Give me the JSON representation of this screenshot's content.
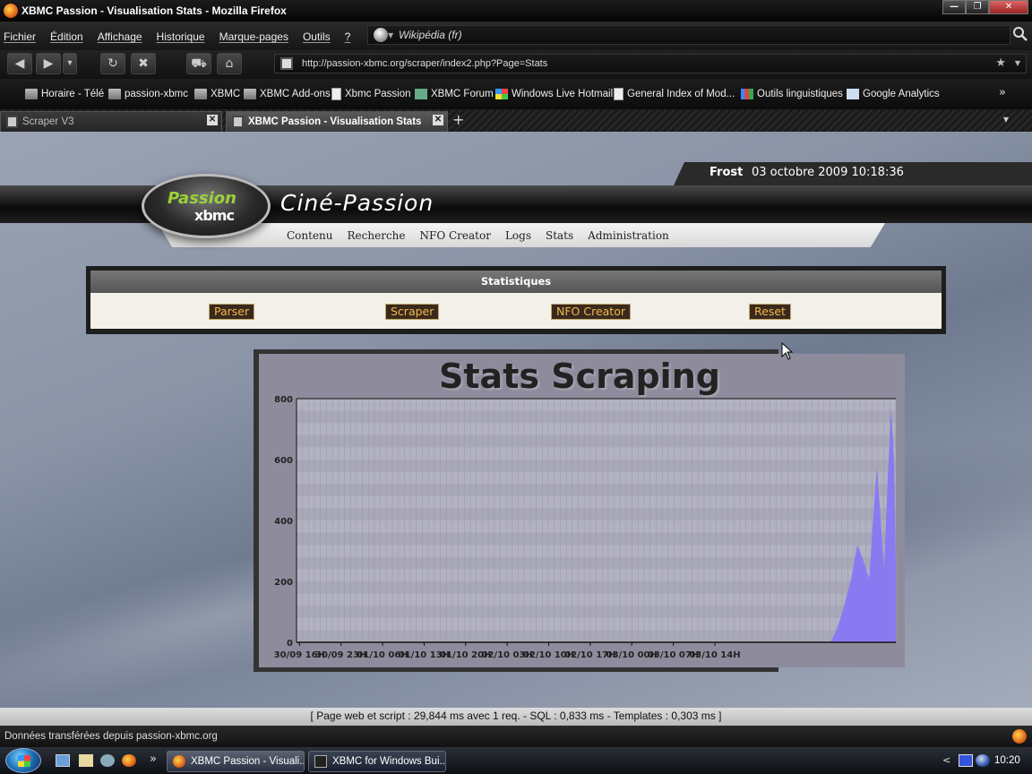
{
  "window": {
    "title": "XBMC Passion - Visualisation Stats - Mozilla Firefox",
    "buttons": {
      "minimize": "—",
      "maximize": "❐",
      "close": "✕"
    }
  },
  "menu": {
    "items": [
      "Fichier",
      "Édition",
      "Affichage",
      "Historique",
      "Marque-pages",
      "Outils",
      "?"
    ]
  },
  "search": {
    "placeholder": "Wikipédia (fr)"
  },
  "nav": {
    "back": "◀",
    "forward": "▶",
    "history": "▾",
    "reload": "↻",
    "stop": "✖",
    "print": "⛟",
    "home": "⌂",
    "url": "http://passion-xbmc.org/scraper/index2.php?Page=Stats",
    "star": "★",
    "dropdown": "▼"
  },
  "bookmarks": [
    {
      "label": "Horaire - Télé",
      "icon": "folder-icon"
    },
    {
      "label": "passion-xbmc",
      "icon": "folder-icon"
    },
    {
      "label": "XBMC",
      "icon": "folder-icon"
    },
    {
      "label": "XBMC Add-ons",
      "icon": "folder-icon"
    },
    {
      "label": "Xbmc Passion",
      "icon": "page-icon"
    },
    {
      "label": "XBMC Forum",
      "icon": "xbmc-icon"
    },
    {
      "label": "Windows Live Hotmail",
      "icon": "windows-icon"
    },
    {
      "label": "General Index of Mod...",
      "icon": "page-icon"
    },
    {
      "label": "Outils linguistiques",
      "icon": "google-icon"
    },
    {
      "label": "Google Analytics",
      "icon": "analytics-icon"
    }
  ],
  "bookmarks_more": "»",
  "tabs": [
    {
      "label": "Scraper V3",
      "active": false
    },
    {
      "label": "XBMC Passion - Visualisation Stats",
      "active": true
    }
  ],
  "tab_close": "✕",
  "new_tab": "+",
  "tab_list": "▾",
  "site": {
    "user": "Frost",
    "datetime": "03 octobre 2009 10:18:36",
    "logo_top": "Passion",
    "logo_bottom": "xbmc",
    "name": "Ciné-Passion",
    "nav": [
      "Contenu",
      "Recherche",
      "NFO Creator",
      "Logs",
      "Stats",
      "Administration"
    ]
  },
  "stats": {
    "heading": "Statistiques",
    "buttons": [
      "Parser",
      "Scraper",
      "NFO Creator",
      "Reset"
    ]
  },
  "chart_data": {
    "type": "area",
    "title": "Stats Scraping",
    "xlabel": "",
    "ylabel": "",
    "ylim": [
      0,
      800
    ],
    "yticks": [
      0,
      200,
      400,
      600,
      800
    ],
    "xticks": [
      "30/09 16H",
      "30/09 23H",
      "01/10 06H",
      "01/10 13H",
      "01/10 20H",
      "02/10 03H",
      "02/10 10H",
      "02/10 17H",
      "03/10 00H",
      "03/10 07H",
      "03/10 14H"
    ],
    "grid": true,
    "legend": "none",
    "series_color": "#8a7af2",
    "x_range_hours": [
      0,
      101
    ],
    "points": [
      {
        "h": 0,
        "v": 0
      },
      {
        "h": 90,
        "v": 0
      },
      {
        "h": 91,
        "v": 40
      },
      {
        "h": 92,
        "v": 100
      },
      {
        "h": 93.5,
        "v": 210
      },
      {
        "h": 94.5,
        "v": 320
      },
      {
        "h": 95.5,
        "v": 270
      },
      {
        "h": 96.5,
        "v": 210
      },
      {
        "h": 97.2,
        "v": 410
      },
      {
        "h": 97.8,
        "v": 575
      },
      {
        "h": 98.4,
        "v": 420
      },
      {
        "h": 99,
        "v": 240
      },
      {
        "h": 99.6,
        "v": 520
      },
      {
        "h": 100.2,
        "v": 770
      },
      {
        "h": 100.7,
        "v": 600
      },
      {
        "h": 101,
        "v": 250
      },
      {
        "h": 101,
        "v": 0
      }
    ]
  },
  "footer": "[ Page web et script : 29,844 ms avec 1 req. - SQL : 0,833 ms - Templates : 0,303 ms ]",
  "status": "Données transférées depuis passion-xbmc.org",
  "taskbar": {
    "items": [
      "XBMC Passion - Visuali...",
      "XBMC for Windows Bui..."
    ],
    "quicklaunch_more": "»",
    "tray_arrow": "<",
    "clock": "10:20"
  }
}
